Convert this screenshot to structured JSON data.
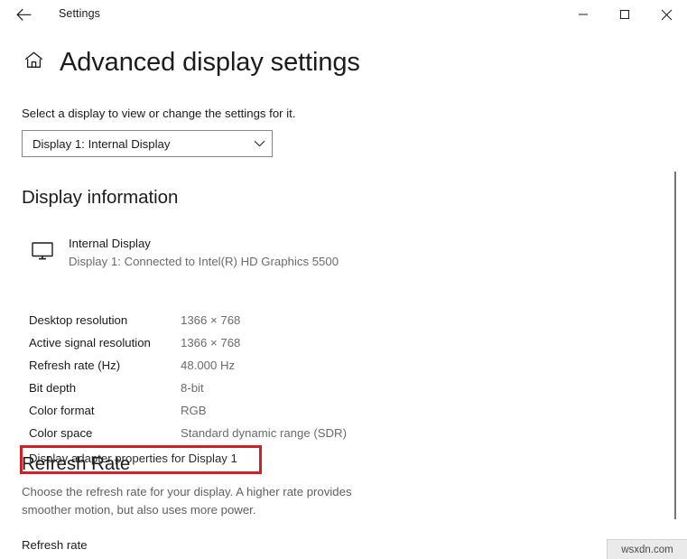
{
  "window": {
    "app_title": "Settings",
    "back_icon": "back-arrow-icon",
    "minimize_icon": "minimize-icon",
    "maximize_icon": "maximize-icon",
    "close_icon": "close-icon"
  },
  "page": {
    "home_icon": "home-icon",
    "title": "Advanced display settings",
    "intro": "Select a display to view or change the settings for it."
  },
  "display_selector": {
    "value": "Display 1: Internal Display",
    "chevron_icon": "chevron-down-icon",
    "options": [
      "Display 1: Internal Display"
    ]
  },
  "display_information": {
    "heading": "Display information",
    "monitor_icon": "monitor-icon",
    "monitor_name": "Internal Display",
    "monitor_subtitle": "Display 1: Connected to Intel(R) HD Graphics 5500",
    "rows": [
      {
        "label": "Desktop resolution",
        "value": "1366 × 768"
      },
      {
        "label": "Active signal resolution",
        "value": "1366 × 768"
      },
      {
        "label": "Refresh rate (Hz)",
        "value": "48.000 Hz"
      },
      {
        "label": "Bit depth",
        "value": "8-bit"
      },
      {
        "label": "Color format",
        "value": "RGB"
      },
      {
        "label": "Color space",
        "value": "Standard dynamic range (SDR)"
      }
    ],
    "adapter_link": "Display adapter properties for Display 1"
  },
  "refresh_rate_section": {
    "heading": "Refresh Rate",
    "description": "Choose the refresh rate for your display. A higher rate provides smoother motion, but also uses more power.",
    "field_label": "Refresh rate"
  },
  "annotation": {
    "highlight_color": "#cf2027"
  },
  "watermark": {
    "text": "wsxdn.com"
  }
}
